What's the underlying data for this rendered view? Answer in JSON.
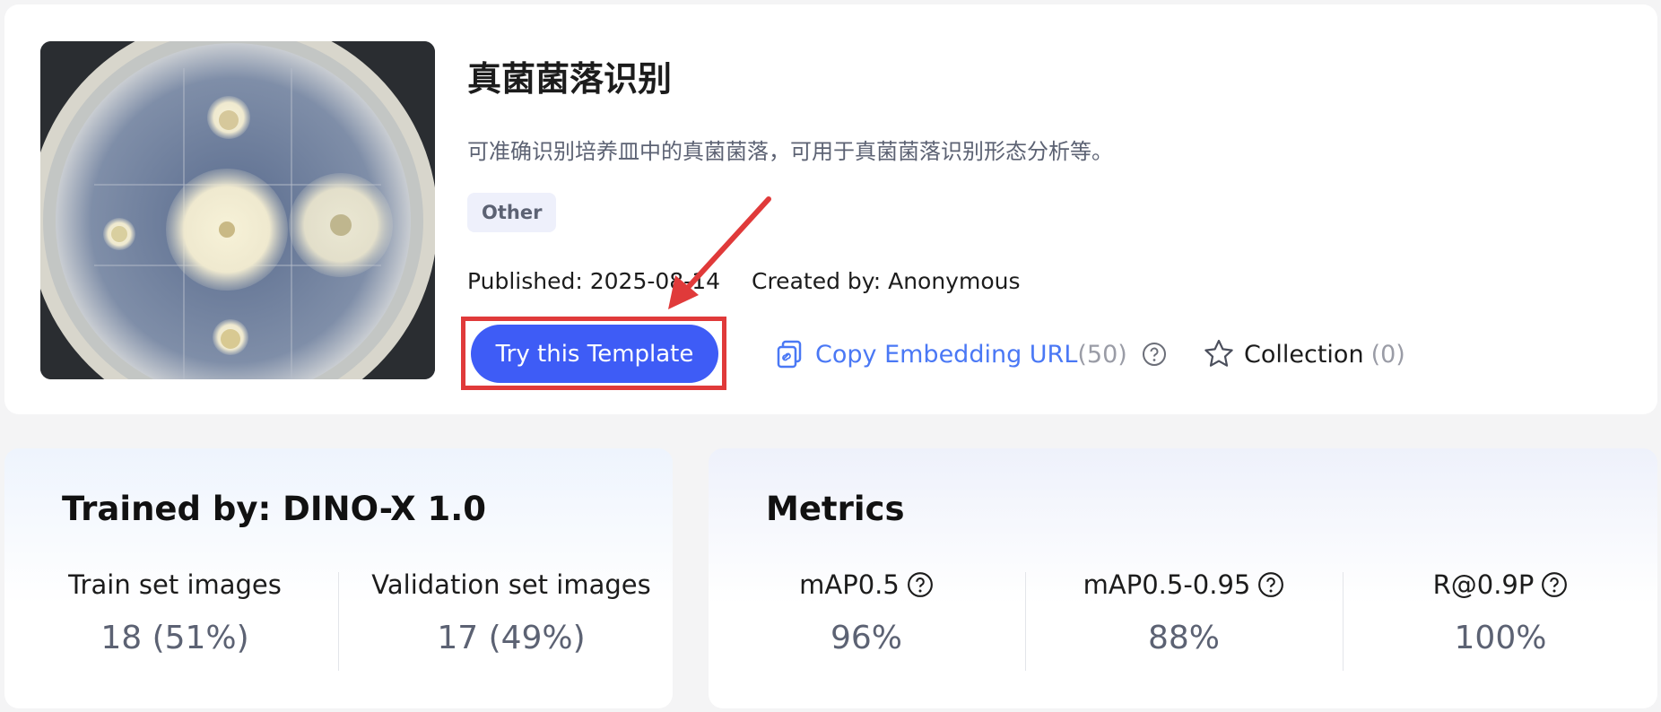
{
  "template": {
    "title": "真菌菌落识别",
    "description": "可准确识别培养皿中的真菌菌落，可用于真菌菌落识别形态分析等。",
    "tag": "Other",
    "published": "Published: 2025-08-14",
    "created_by": "Created by: Anonymous",
    "thumbnail_icon": "petri-dish-image"
  },
  "actions": {
    "try_label": "Try this Template",
    "copy_url_label": "Copy Embedding URL",
    "copy_url_count": "(50)",
    "collection_label": "Collection",
    "collection_count": "(0)"
  },
  "training": {
    "title": "Trained by: DINO-X 1.0",
    "train_label": "Train set images",
    "train_value": "18 (51%)",
    "val_label": "Validation set images",
    "val_value": "17 (49%)"
  },
  "metrics": {
    "title": "Metrics",
    "items": [
      {
        "label": "mAP0.5",
        "value": "96%"
      },
      {
        "label": "mAP0.5-0.95",
        "value": "88%"
      },
      {
        "label": "R@0.9P",
        "value": "100%"
      }
    ]
  },
  "colors": {
    "primary": "#3e5cf6",
    "link": "#4a78f5",
    "highlight": "#e03a3a"
  }
}
